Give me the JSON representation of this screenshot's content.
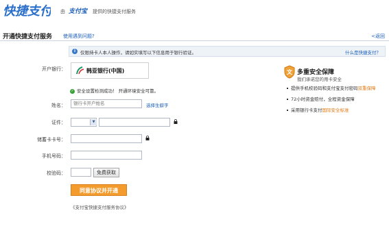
{
  "header": {
    "logo_text": "快捷支付",
    "by_text": "由",
    "alipay_text": "支付宝",
    "desc_text": "提供的快捷支付服务"
  },
  "page": {
    "title": "开通快捷支付服务",
    "help_link": "使用遇到问题?",
    "back_link": "<返回"
  },
  "notice": {
    "text": "仅限持卡人本人操作，请如实填写以下信息用于银行验证。",
    "link": "什么是快捷支付？"
  },
  "form": {
    "bank_label": "开户银行：",
    "bank_name": "韩亚银行(中国)",
    "security_text": "安全设置检测成功！ 开通环境安全可靠。",
    "name_label": "姓名：",
    "name_placeholder": "银行卡开户姓名",
    "rare_char_link": "选择生僻字",
    "id_label": "证件：",
    "card_label": "储蓄卡卡号：",
    "phone_label": "手机号码：",
    "code_label": "校验码：",
    "get_code_button": "免费获取",
    "submit_button": "同意协议并开通",
    "agreement_link": "《支付宝快捷支付服务协议》"
  },
  "sidebar": {
    "title": "多重安全保障",
    "subtitle": "我们承诺您的用卡安全",
    "items": [
      {
        "text": "提供手机校验码和支付宝支付密码",
        "highlight": "双重保障"
      },
      {
        "text": "72小时资金赔付，全程资金保障",
        "highlight": ""
      },
      {
        "text": "采用银行卡支付",
        "highlight": "国际安全标准"
      }
    ]
  },
  "colors": {
    "accent": "#f39b2c",
    "link": "#1a5eb8",
    "logo": "#2a6fc9"
  }
}
